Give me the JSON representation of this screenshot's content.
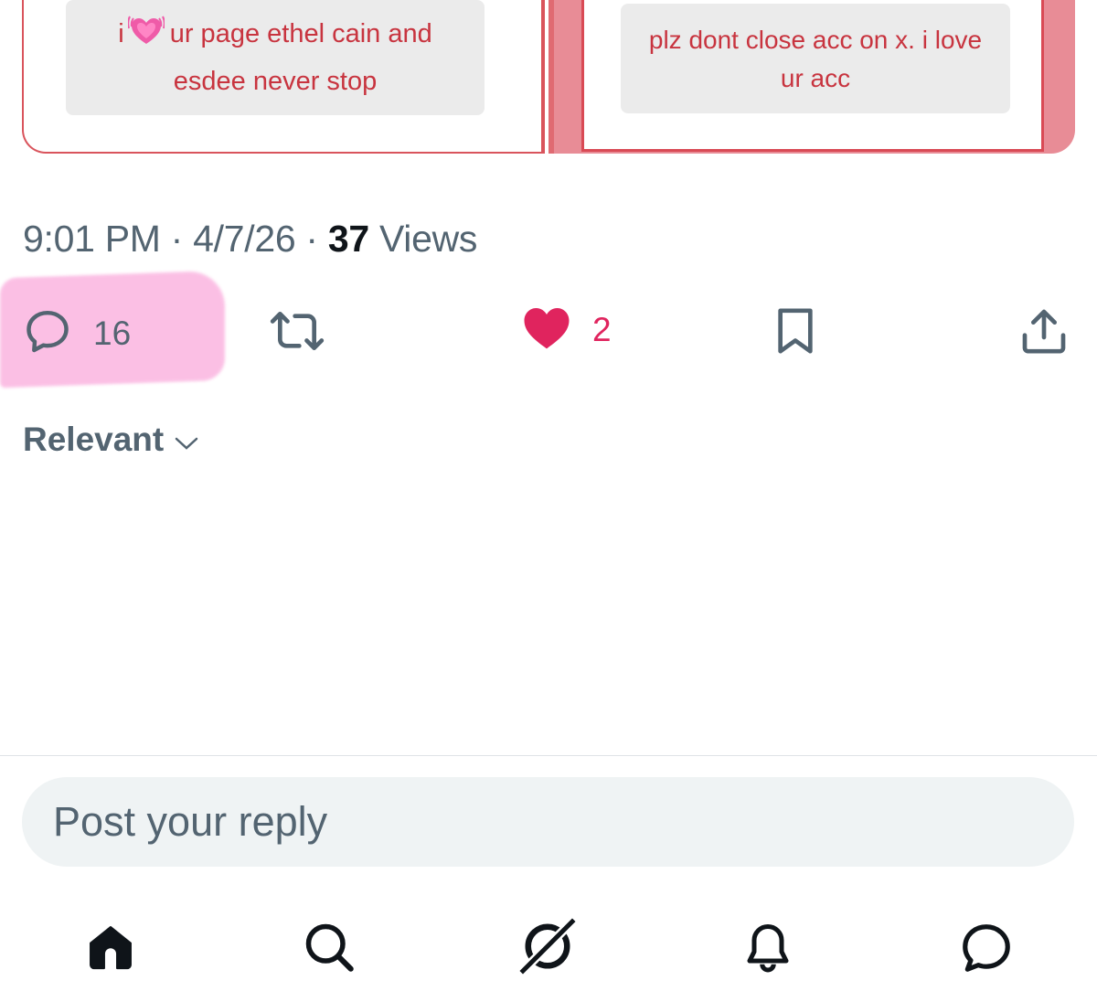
{
  "media": {
    "left_text_prefix": "i",
    "left_text_emoji": "growing-heart",
    "left_text_rest": "ur page ethel cain and",
    "left_text_line2": "esdee never stop",
    "right_text_line1": "plz dont close acc on x. i love",
    "right_text_line2": "ur acc"
  },
  "meta": {
    "time": "9:01 PM",
    "sep1": " · ",
    "date": "4/7/26",
    "sep2": " · ",
    "views_count": "37",
    "views_label": " Views"
  },
  "actions": {
    "reply_count": "16",
    "like_count": "2",
    "liked": true,
    "like_color": "#e0245e",
    "highlight_color": "#fbb9e2"
  },
  "sort": {
    "label": "Relevant"
  },
  "composer": {
    "placeholder": "Post your reply"
  },
  "tabbar": {
    "items": [
      "home-icon",
      "search-icon",
      "grok-icon",
      "notifications-icon",
      "messages-icon"
    ]
  }
}
